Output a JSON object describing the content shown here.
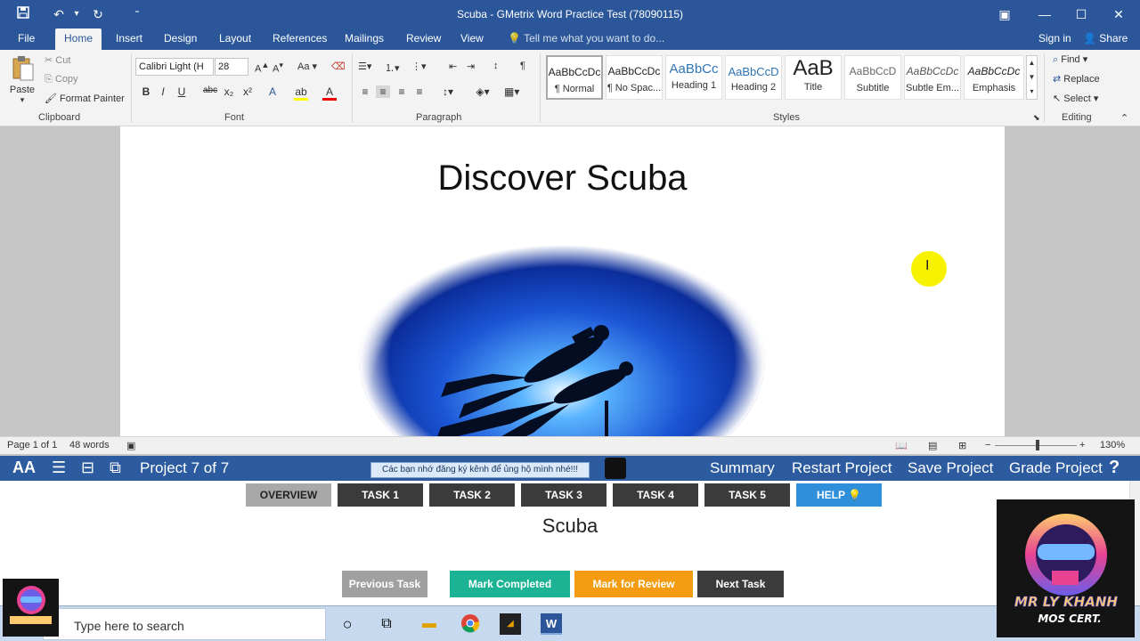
{
  "window": {
    "title": "Scuba - GMetrix Word Practice Test (78090115)"
  },
  "quick_access": {
    "save_icon": "save-icon",
    "undo_icon": "undo-icon",
    "redo_icon": "redo-icon"
  },
  "tabs": [
    {
      "label": "File"
    },
    {
      "label": "Home"
    },
    {
      "label": "Insert"
    },
    {
      "label": "Design"
    },
    {
      "label": "Layout"
    },
    {
      "label": "References"
    },
    {
      "label": "Mailings"
    },
    {
      "label": "Review"
    },
    {
      "label": "View"
    }
  ],
  "tellme": "Tell me what you want to do...",
  "signin": "Sign in",
  "share": "Share",
  "clipboard": {
    "paste": "Paste",
    "cut": "Cut",
    "copy": "Copy",
    "format_painter": "Format Painter",
    "label": "Clipboard"
  },
  "font": {
    "name": "Calibri Light (H",
    "size": "28",
    "label": "Font"
  },
  "paragraph": {
    "label": "Paragraph"
  },
  "styles": {
    "label": "Styles",
    "items": [
      {
        "preview": "AaBbCcDc",
        "name": "¶ Normal"
      },
      {
        "preview": "AaBbCcDc",
        "name": "¶ No Spac..."
      },
      {
        "preview": "AaBbCc",
        "name": "Heading 1"
      },
      {
        "preview": "AaBbCcD",
        "name": "Heading 2"
      },
      {
        "preview": "AaB",
        "name": "Title"
      },
      {
        "preview": "AaBbCcD",
        "name": "Subtitle"
      },
      {
        "preview": "AaBbCcDc",
        "name": "Subtle Em..."
      },
      {
        "preview": "AaBbCcDc",
        "name": "Emphasis"
      }
    ]
  },
  "editing": {
    "find": "Find",
    "replace": "Replace",
    "select": "Select",
    "label": "Editing"
  },
  "document": {
    "title": "Discover Scuba"
  },
  "status": {
    "page": "Page 1 of 1",
    "words": "48 words",
    "zoom": "130%"
  },
  "gmetrix": {
    "project": "Project 7 of 7",
    "notice": "Các bạn nhớ đăng ký kênh để ủng hộ mình nhé!!!",
    "summary": "Summary",
    "restart": "Restart Project",
    "save": "Save Project",
    "grade": "Grade Project",
    "help_glyph": "?",
    "tasks": [
      "OVERVIEW",
      "TASK 1",
      "TASK 2",
      "TASK 3",
      "TASK 4",
      "TASK 5",
      "HELP"
    ],
    "project_title": "Scuba",
    "prev": "Previous Task",
    "mark_completed": "Mark Completed",
    "mark_review": "Mark for Review",
    "next": "Next Task",
    "colors": {
      "completed": "#1bb394",
      "review": "#f39c12",
      "prev": "#a0a0a0",
      "next": "#3b3b3b"
    }
  },
  "taskbar": {
    "search": "Type here to search"
  },
  "logo": {
    "text1": "MR LY KHANH",
    "text2": "MOS CERT."
  }
}
